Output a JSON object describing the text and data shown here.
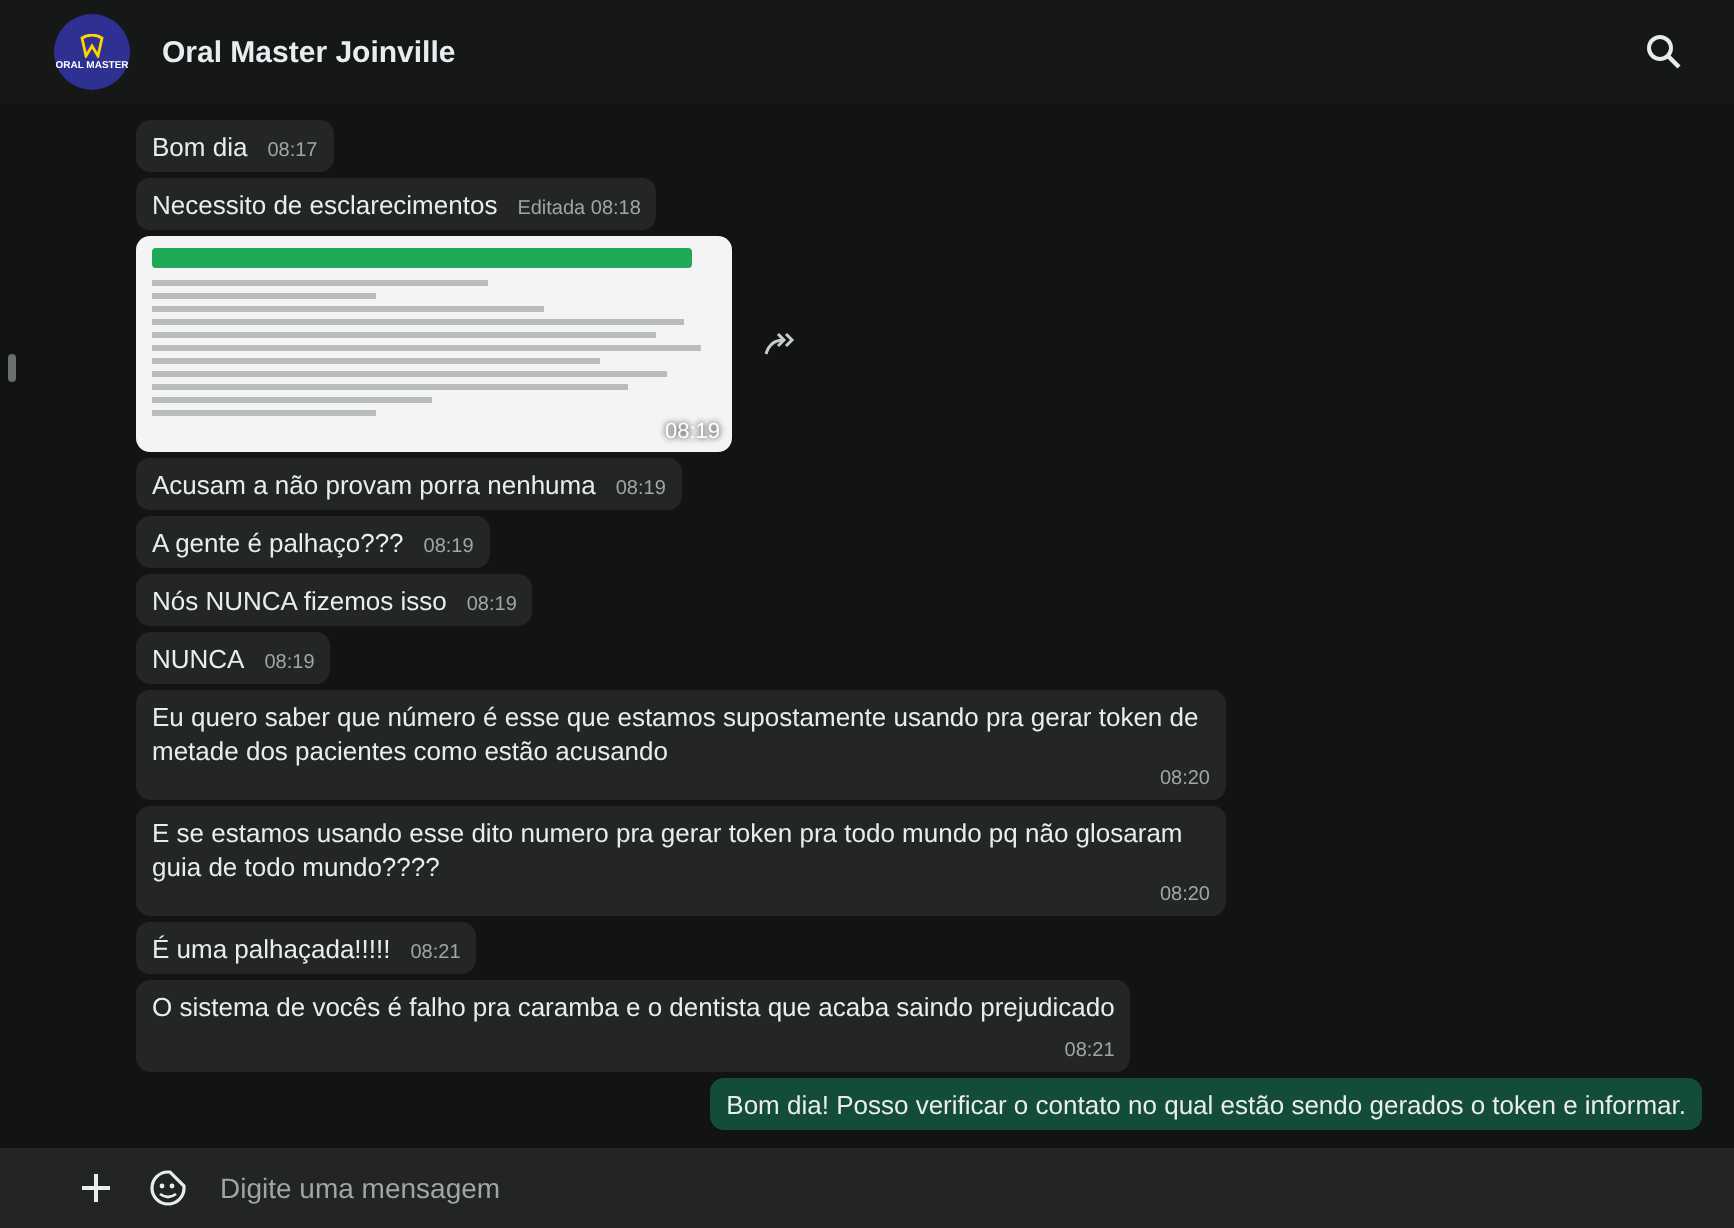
{
  "header": {
    "title": "Oral Master Joinville",
    "avatar_text": "ORAL MASTER"
  },
  "messages": [
    {
      "kind": "text",
      "outgoing": false,
      "text": "Bom dia",
      "time": "08:17"
    },
    {
      "kind": "text",
      "outgoing": false,
      "text": "Necessito de esclarecimentos",
      "edited": "Editada",
      "time": "08:18"
    },
    {
      "kind": "image",
      "outgoing": false,
      "time": "08:19"
    },
    {
      "kind": "text",
      "outgoing": false,
      "text": "Acusam a não provam porra nenhuma",
      "time": "08:19"
    },
    {
      "kind": "text",
      "outgoing": false,
      "text": "A gente é palhaço???",
      "time": "08:19"
    },
    {
      "kind": "text",
      "outgoing": false,
      "text": "Nós NUNCA fizemos isso",
      "time": "08:19"
    },
    {
      "kind": "text",
      "outgoing": false,
      "text": "NUNCA",
      "time": "08:19"
    },
    {
      "kind": "text",
      "outgoing": false,
      "text": "Eu quero saber que número é esse que estamos supostamente usando pra gerar token de metade dos pacientes como estão acusando",
      "time": "08:20"
    },
    {
      "kind": "text",
      "outgoing": false,
      "text": "E se estamos usando esse dito numero pra gerar token pra todo mundo pq não glosaram guia de todo mundo????",
      "time": "08:20"
    },
    {
      "kind": "text",
      "outgoing": false,
      "text": "É uma palhaçada!!!!!",
      "time": "08:21"
    },
    {
      "kind": "text",
      "outgoing": false,
      "text": "O sistema de vocês é falho pra caramba e o dentista que acaba saindo prejudicado",
      "time": "08:21",
      "tall": true
    },
    {
      "kind": "text",
      "outgoing": true,
      "text": "Bom dia! Posso verificar o contato no qual estão sendo gerados o token e informar."
    }
  ],
  "compose": {
    "placeholder": "Digite uma mensagem"
  }
}
